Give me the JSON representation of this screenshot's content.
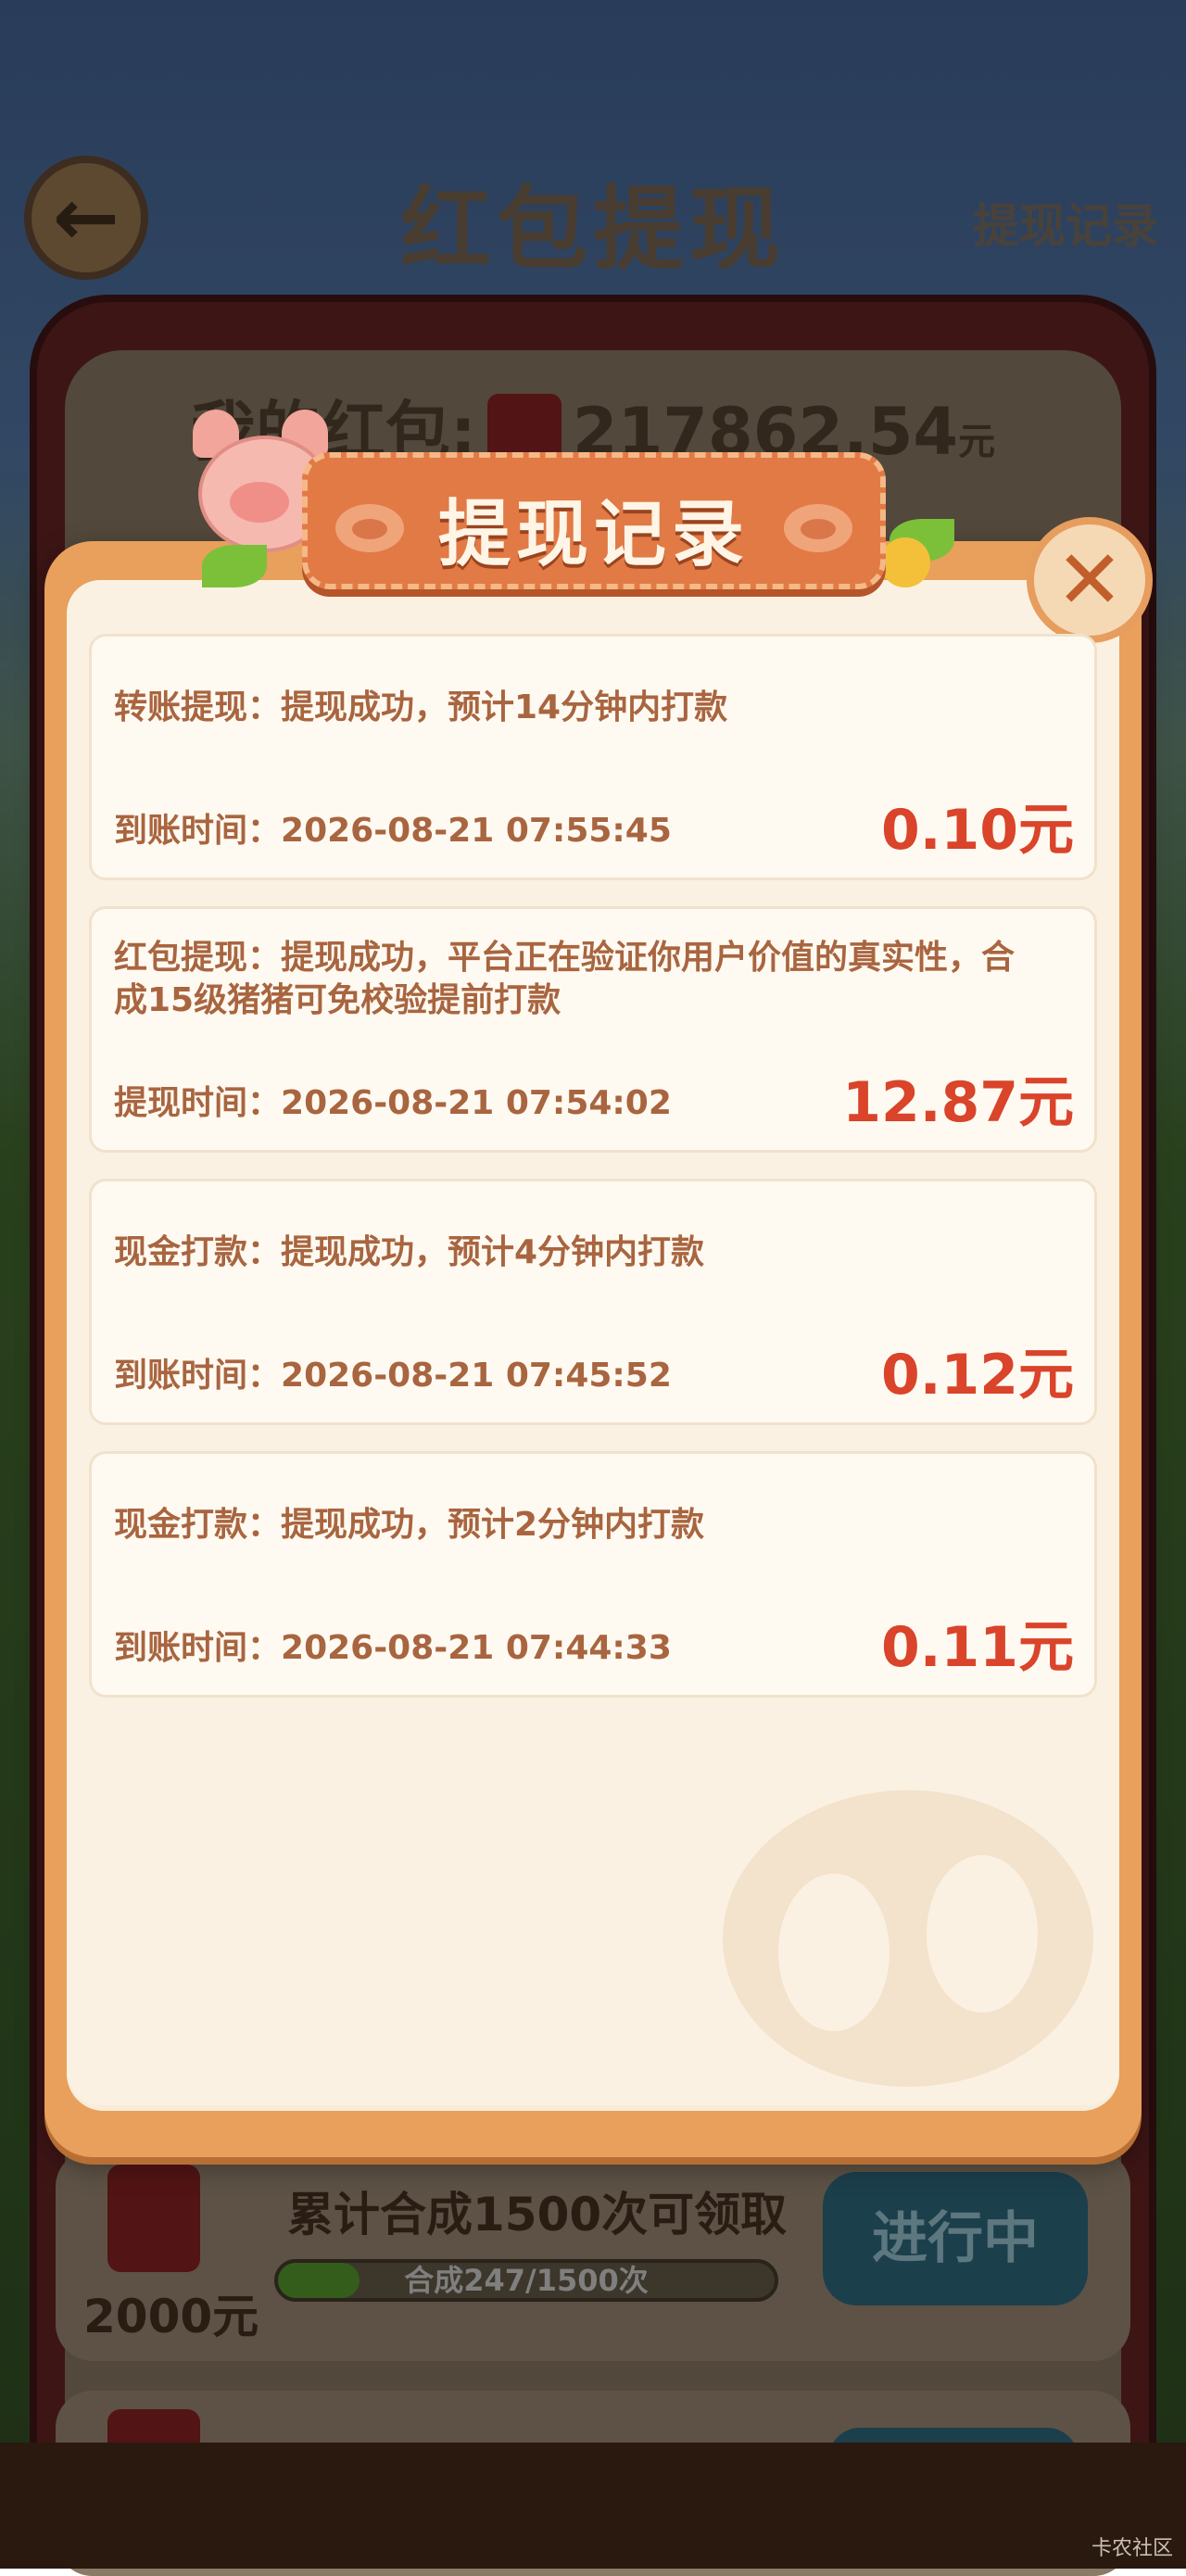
{
  "header": {
    "back_icon": "arrow-left-icon",
    "title": "红包提现",
    "history_link": "提现记录"
  },
  "balance": {
    "label": "我的红包:",
    "amount": "217862.54",
    "unit": "元"
  },
  "task": {
    "reward": "2000元",
    "title": "累计合成1500次可领取",
    "progress_text": "合成247/1500次",
    "progress_fraction": 0.165,
    "button": "进行中"
  },
  "modal": {
    "title": "提现记录",
    "close_icon": "close-icon",
    "records": [
      {
        "description": "转账提现：提现成功，预计14分钟内打款",
        "time_label": "到账时间：",
        "time": "2026-08-21 07:55:45",
        "amount": "0.10元"
      },
      {
        "description": "红包提现：提现成功，平台正在验证你用户价值的真实性，合成15级猪猪可免校验提前打款",
        "time_label": "提现时间：",
        "time": "2026-08-21 07:54:02",
        "amount": "12.87元"
      },
      {
        "description": "现金打款：提现成功，预计4分钟内打款",
        "time_label": "到账时间：",
        "time": "2026-08-21 07:45:52",
        "amount": "0.12元"
      },
      {
        "description": "现金打款：提现成功，预计2分钟内打款",
        "time_label": "到账时间：",
        "time": "2026-08-21 07:44:33",
        "amount": "0.11元"
      }
    ]
  },
  "watermark": "卡农社区",
  "colors": {
    "amount_red": "#d9442a",
    "text_brown": "#a86540",
    "modal_orange": "#e8a05c",
    "banner_orange": "#e27a45"
  }
}
